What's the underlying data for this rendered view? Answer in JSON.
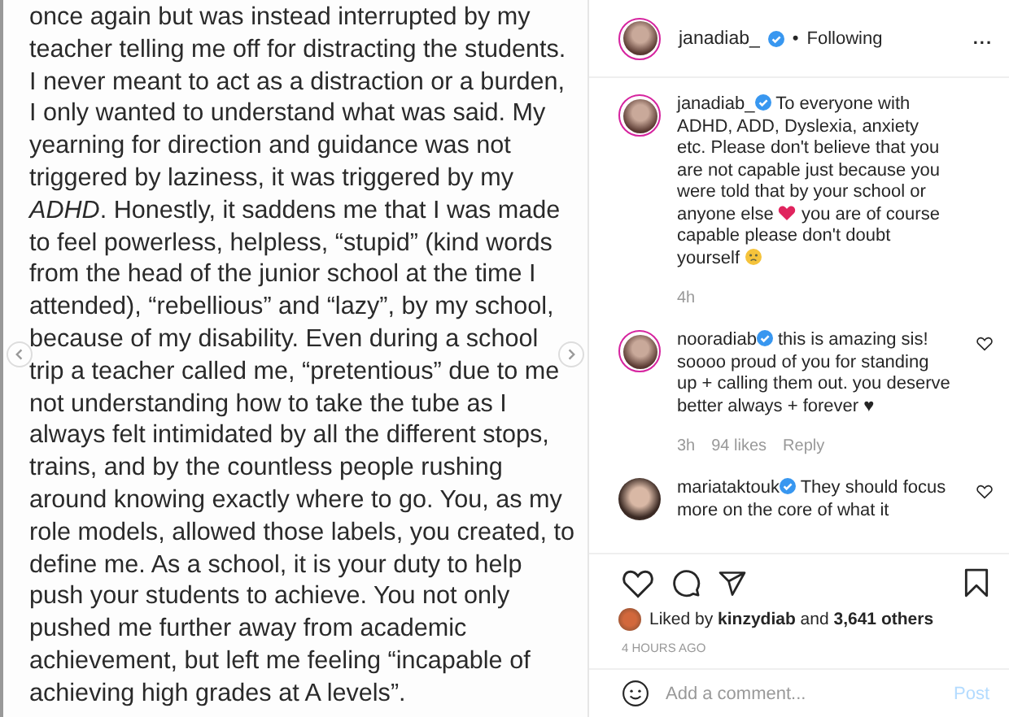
{
  "post_image": {
    "lines": [
      "once again but was instead interrupted by my",
      "teacher telling me off for distracting the students.",
      "I never meant to act as a distraction or a burden,",
      "I only wanted to understand what was said. My",
      "yearning for direction and guidance was not",
      "triggered by laziness, it was triggered by my",
      "*ADHD*. Honestly, it saddens me that I was made",
      "to feel powerless, helpless, “stupid” (kind words",
      "from the head of the junior school at the time I",
      "attended), “rebellious” and “lazy”, by my school,",
      "because of my disability. Even during a school",
      "trip a teacher called me, “pretentious” due to me",
      "not understanding how to take the tube as I",
      "always felt intimidated by all the different stops,",
      "trains, and by the countless people rushing",
      "around knowing exactly where to go. You, as my",
      "role models, allowed those labels, you created, to",
      "define me. As a school, it is your duty to help",
      "push your students to achieve. You not only",
      "pushed me further away from academic",
      "achievement, but left me feeling “incapable of",
      "achieving high grades at A levels”."
    ]
  },
  "header": {
    "username": "janadiab_",
    "verified": true,
    "separator": "•",
    "follow_status": "Following",
    "more": "..."
  },
  "caption": {
    "username": "janadiab_",
    "verified": true,
    "text_before": "To everyone with ADHD, ADD, Dyslexia, anxiety etc. Please don't believe that you are not capable just because you were told that by your school or anyone else",
    "text_middle": "you are of course capable please don't doubt yourself",
    "time": "4h"
  },
  "comments": [
    {
      "username": "nooradiab",
      "verified": true,
      "text": "this is amazing sis! soooo proud of you for standing up + calling them out. you deserve better always + forever ♥",
      "time": "3h",
      "likes": "94 likes",
      "reply": "Reply",
      "liked": false
    },
    {
      "username": "mariataktouk",
      "verified": true,
      "text": "They should focus more on the core of what it",
      "liked": false
    }
  ],
  "likes": {
    "prefix": "Liked by",
    "user": "kinzydiab",
    "middle": "and",
    "others": "3,641 others"
  },
  "timestamp": "4 HOURS AGO",
  "comment_field": {
    "placeholder": "Add a comment...",
    "button": "Post"
  }
}
